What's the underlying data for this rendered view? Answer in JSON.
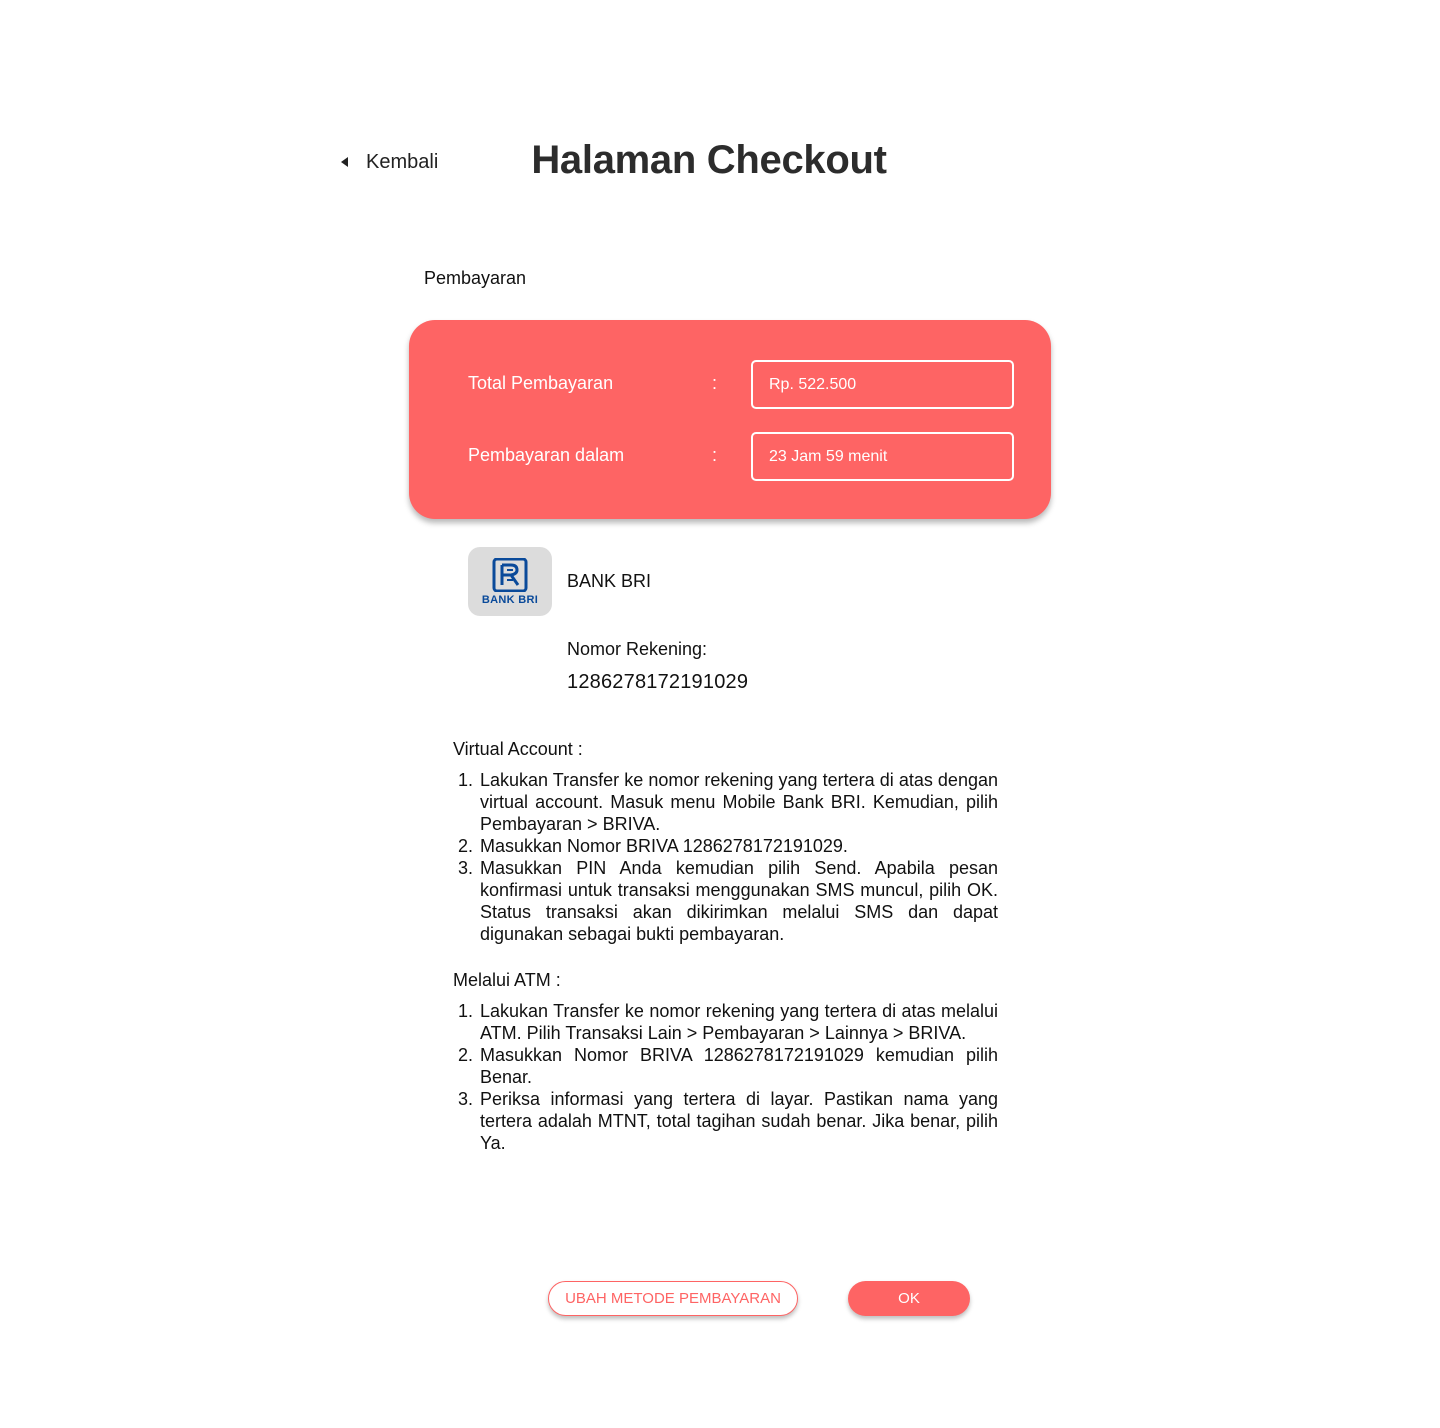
{
  "header": {
    "back_label": "Kembali",
    "title": "Halaman Checkout"
  },
  "payment": {
    "section_label": "Pembayaran",
    "card_color": "#fe6464",
    "rows": [
      {
        "label": "Total Pembayaran",
        "colon": ":",
        "value": "Rp. 522.500"
      },
      {
        "label": "Pembayaran dalam",
        "colon": ":",
        "value": "23 Jam 59 menit"
      }
    ]
  },
  "bank": {
    "logo_icon": "bank-bri-logo-icon",
    "logo_text": "BANK BRI",
    "name": "BANK BRI",
    "account_label": "Nomor Rekening:",
    "account_number": "1286278172191029"
  },
  "instructions": {
    "virtual_account": {
      "title": "Virtual Account :",
      "steps": [
        {
          "num": "1.",
          "text": "Lakukan Transfer ke nomor rekening yang tertera di atas dengan virtual account. Masuk menu Mobile Bank BRI. Kemudian, pilih Pembayaran > BRIVA."
        },
        {
          "num": "2.",
          "text": "Masukkan Nomor BRIVA 1286278172191029."
        },
        {
          "num": "3.",
          "text": "Masukkan PIN Anda kemudian pilih Send. Apabila pesan konfirmasi untuk transaksi menggunakan SMS muncul, pilih OK. Status transaksi akan dikirimkan melalui SMS dan dapat digunakan sebagai bukti pembayaran."
        }
      ]
    },
    "atm": {
      "title": "Melalui ATM :",
      "steps": [
        {
          "num": "1.",
          "text": "Lakukan Transfer ke nomor rekening yang tertera di atas melalui ATM. Pilih Transaksi Lain > Pembayaran > Lainnya > BRIVA."
        },
        {
          "num": "2.",
          "text": "Masukkan Nomor BRIVA 1286278172191029 kemudian pilih Benar."
        },
        {
          "num": "3.",
          "text": "Periksa informasi yang tertera di layar. Pastikan nama yang tertera adalah MTNT, total tagihan sudah benar. Jika benar, pilih Ya."
        }
      ]
    }
  },
  "actions": {
    "change_method_label": "UBAH METODE PEMBAYARAN",
    "ok_label": "OK"
  }
}
